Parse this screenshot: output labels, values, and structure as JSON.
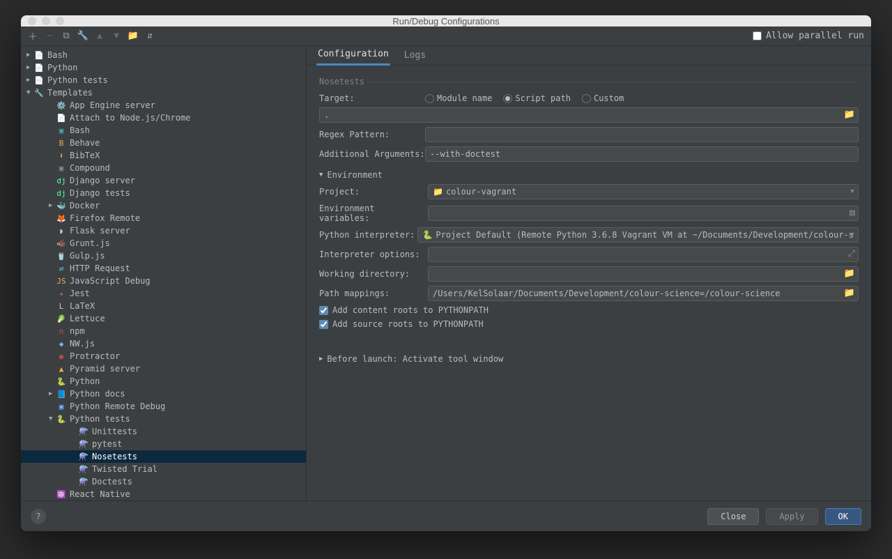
{
  "window_title": "Run/Debug Configurations",
  "allow_parallel_label": "Allow parallel run",
  "tree": {
    "roots": [
      "Bash",
      "Python",
      "Python tests"
    ],
    "templates_label": "Templates",
    "templates": [
      {
        "icon": "⚙️",
        "color": "",
        "label": "App Engine server"
      },
      {
        "icon": "📄",
        "color": "",
        "label": "Attach to Node.js/Chrome"
      },
      {
        "icon": "▣",
        "color": "#4aa",
        "label": "Bash"
      },
      {
        "icon": "B",
        "color": "#e0b050",
        "label": "Behave"
      },
      {
        "icon": "⬇",
        "color": "#e0b050",
        "label": "BibTeX"
      },
      {
        "icon": "▣",
        "color": "#888",
        "label": "Compound"
      },
      {
        "icon": "dj",
        "color": "#5fa",
        "label": "Django server"
      },
      {
        "icon": "dj",
        "color": "#5fa",
        "label": "Django tests"
      },
      {
        "icon": "🐳",
        "color": "",
        "label": "Docker",
        "expandable": true
      },
      {
        "icon": "🦊",
        "color": "",
        "label": "Firefox Remote"
      },
      {
        "icon": "◗",
        "color": "#ccc",
        "label": "Flask server"
      },
      {
        "icon": "🐗",
        "color": "",
        "label": "Grunt.js"
      },
      {
        "icon": "🥤",
        "color": "",
        "label": "Gulp.js"
      },
      {
        "icon": "⇄",
        "color": "#6cb5ff",
        "label": "HTTP Request"
      },
      {
        "icon": "JS",
        "color": "#e0b050",
        "label": "JavaScript Debug"
      },
      {
        "icon": "✦",
        "color": "#c25b7a",
        "label": "Jest"
      },
      {
        "icon": "L",
        "color": "#ccc",
        "label": "LaTeX"
      },
      {
        "icon": "🥬",
        "color": "",
        "label": "Lettuce"
      },
      {
        "icon": "n",
        "color": "#c84b4b",
        "label": "npm"
      },
      {
        "icon": "◆",
        "color": "#6cb5ff",
        "label": "NW.js"
      },
      {
        "icon": "◉",
        "color": "#c84b4b",
        "label": "Protractor"
      },
      {
        "icon": "▲",
        "color": "#e0b050",
        "label": "Pyramid server"
      },
      {
        "icon": "🐍",
        "color": "",
        "label": "Python"
      },
      {
        "icon": "📘",
        "color": "",
        "label": "Python docs",
        "expandable": true
      },
      {
        "icon": "▣",
        "color": "#6cb5ff",
        "label": "Python Remote Debug"
      }
    ],
    "python_tests_label": "Python tests",
    "python_tests": [
      "Unittests",
      "pytest",
      "Nosetests",
      "Twisted Trial",
      "Doctests"
    ],
    "selected": "Nosetests",
    "last_item": "React Native"
  },
  "tabs": {
    "active": "Configuration",
    "other": "Logs"
  },
  "form": {
    "section": "Nosetests",
    "target_label": "Target:",
    "target_options": [
      "Module name",
      "Script path",
      "Custom"
    ],
    "target_selected": "Script path",
    "target_value": ".",
    "regex_label": "Regex Pattern:",
    "regex_value": "",
    "args_label": "Additional Arguments:",
    "args_value": "--with-doctest",
    "env_section": "Environment",
    "project_label": "Project:",
    "project_value": "colour-vagrant",
    "envvars_label": "Environment variables:",
    "envvars_value": "",
    "interpreter_label": "Python interpreter:",
    "interpreter_value": "Project Default (Remote Python 3.6.8 Vagrant VM at ~/Documents/Development/colour-s",
    "interp_opts_label": "Interpreter options:",
    "interp_opts_value": "",
    "workdir_label": "Working directory:",
    "workdir_value": "",
    "pathmap_label": "Path mappings:",
    "pathmap_value": "/Users/KelSolaar/Documents/Development/colour-science=/colour-science",
    "cb1": "Add content roots to PYTHONPATH",
    "cb2": "Add source roots to PYTHONPATH",
    "before_launch": "Before launch: Activate tool window"
  },
  "buttons": {
    "close": "Close",
    "apply": "Apply",
    "ok": "OK"
  }
}
